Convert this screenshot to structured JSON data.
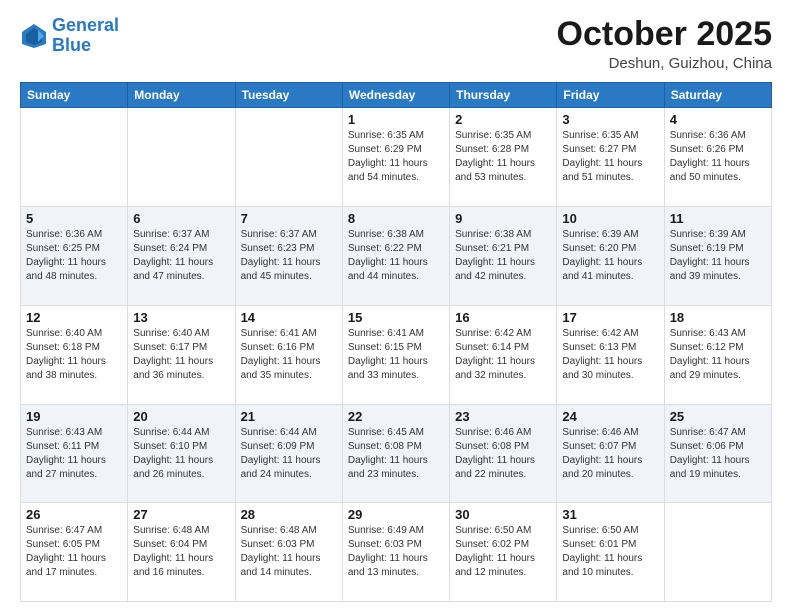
{
  "header": {
    "logo_line1": "General",
    "logo_line2": "Blue",
    "month": "October 2025",
    "location": "Deshun, Guizhou, China"
  },
  "weekdays": [
    "Sunday",
    "Monday",
    "Tuesday",
    "Wednesday",
    "Thursday",
    "Friday",
    "Saturday"
  ],
  "weeks": [
    [
      {
        "day": "",
        "info": ""
      },
      {
        "day": "",
        "info": ""
      },
      {
        "day": "",
        "info": ""
      },
      {
        "day": "1",
        "info": "Sunrise: 6:35 AM\nSunset: 6:29 PM\nDaylight: 11 hours\nand 54 minutes."
      },
      {
        "day": "2",
        "info": "Sunrise: 6:35 AM\nSunset: 6:28 PM\nDaylight: 11 hours\nand 53 minutes."
      },
      {
        "day": "3",
        "info": "Sunrise: 6:35 AM\nSunset: 6:27 PM\nDaylight: 11 hours\nand 51 minutes."
      },
      {
        "day": "4",
        "info": "Sunrise: 6:36 AM\nSunset: 6:26 PM\nDaylight: 11 hours\nand 50 minutes."
      }
    ],
    [
      {
        "day": "5",
        "info": "Sunrise: 6:36 AM\nSunset: 6:25 PM\nDaylight: 11 hours\nand 48 minutes."
      },
      {
        "day": "6",
        "info": "Sunrise: 6:37 AM\nSunset: 6:24 PM\nDaylight: 11 hours\nand 47 minutes."
      },
      {
        "day": "7",
        "info": "Sunrise: 6:37 AM\nSunset: 6:23 PM\nDaylight: 11 hours\nand 45 minutes."
      },
      {
        "day": "8",
        "info": "Sunrise: 6:38 AM\nSunset: 6:22 PM\nDaylight: 11 hours\nand 44 minutes."
      },
      {
        "day": "9",
        "info": "Sunrise: 6:38 AM\nSunset: 6:21 PM\nDaylight: 11 hours\nand 42 minutes."
      },
      {
        "day": "10",
        "info": "Sunrise: 6:39 AM\nSunset: 6:20 PM\nDaylight: 11 hours\nand 41 minutes."
      },
      {
        "day": "11",
        "info": "Sunrise: 6:39 AM\nSunset: 6:19 PM\nDaylight: 11 hours\nand 39 minutes."
      }
    ],
    [
      {
        "day": "12",
        "info": "Sunrise: 6:40 AM\nSunset: 6:18 PM\nDaylight: 11 hours\nand 38 minutes."
      },
      {
        "day": "13",
        "info": "Sunrise: 6:40 AM\nSunset: 6:17 PM\nDaylight: 11 hours\nand 36 minutes."
      },
      {
        "day": "14",
        "info": "Sunrise: 6:41 AM\nSunset: 6:16 PM\nDaylight: 11 hours\nand 35 minutes."
      },
      {
        "day": "15",
        "info": "Sunrise: 6:41 AM\nSunset: 6:15 PM\nDaylight: 11 hours\nand 33 minutes."
      },
      {
        "day": "16",
        "info": "Sunrise: 6:42 AM\nSunset: 6:14 PM\nDaylight: 11 hours\nand 32 minutes."
      },
      {
        "day": "17",
        "info": "Sunrise: 6:42 AM\nSunset: 6:13 PM\nDaylight: 11 hours\nand 30 minutes."
      },
      {
        "day": "18",
        "info": "Sunrise: 6:43 AM\nSunset: 6:12 PM\nDaylight: 11 hours\nand 29 minutes."
      }
    ],
    [
      {
        "day": "19",
        "info": "Sunrise: 6:43 AM\nSunset: 6:11 PM\nDaylight: 11 hours\nand 27 minutes."
      },
      {
        "day": "20",
        "info": "Sunrise: 6:44 AM\nSunset: 6:10 PM\nDaylight: 11 hours\nand 26 minutes."
      },
      {
        "day": "21",
        "info": "Sunrise: 6:44 AM\nSunset: 6:09 PM\nDaylight: 11 hours\nand 24 minutes."
      },
      {
        "day": "22",
        "info": "Sunrise: 6:45 AM\nSunset: 6:08 PM\nDaylight: 11 hours\nand 23 minutes."
      },
      {
        "day": "23",
        "info": "Sunrise: 6:46 AM\nSunset: 6:08 PM\nDaylight: 11 hours\nand 22 minutes."
      },
      {
        "day": "24",
        "info": "Sunrise: 6:46 AM\nSunset: 6:07 PM\nDaylight: 11 hours\nand 20 minutes."
      },
      {
        "day": "25",
        "info": "Sunrise: 6:47 AM\nSunset: 6:06 PM\nDaylight: 11 hours\nand 19 minutes."
      }
    ],
    [
      {
        "day": "26",
        "info": "Sunrise: 6:47 AM\nSunset: 6:05 PM\nDaylight: 11 hours\nand 17 minutes."
      },
      {
        "day": "27",
        "info": "Sunrise: 6:48 AM\nSunset: 6:04 PM\nDaylight: 11 hours\nand 16 minutes."
      },
      {
        "day": "28",
        "info": "Sunrise: 6:48 AM\nSunset: 6:03 PM\nDaylight: 11 hours\nand 14 minutes."
      },
      {
        "day": "29",
        "info": "Sunrise: 6:49 AM\nSunset: 6:03 PM\nDaylight: 11 hours\nand 13 minutes."
      },
      {
        "day": "30",
        "info": "Sunrise: 6:50 AM\nSunset: 6:02 PM\nDaylight: 11 hours\nand 12 minutes."
      },
      {
        "day": "31",
        "info": "Sunrise: 6:50 AM\nSunset: 6:01 PM\nDaylight: 11 hours\nand 10 minutes."
      },
      {
        "day": "",
        "info": ""
      }
    ]
  ]
}
